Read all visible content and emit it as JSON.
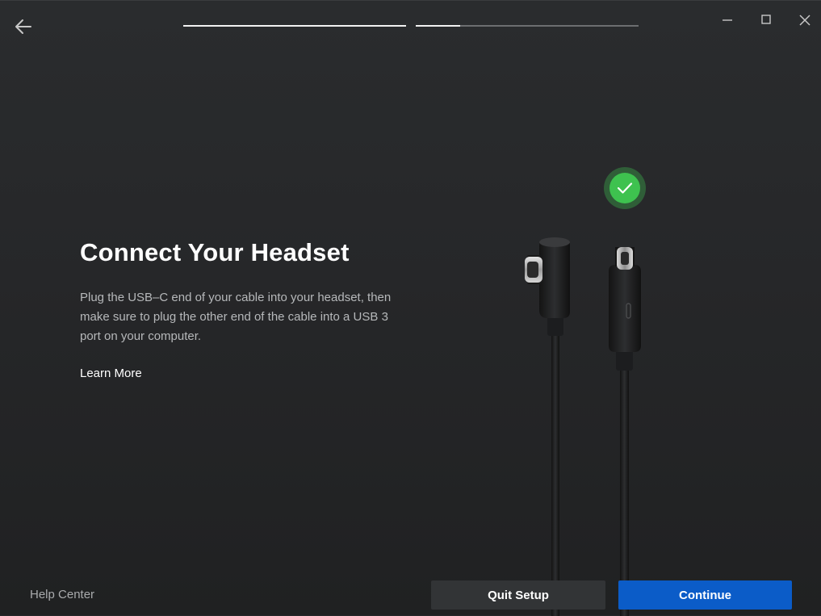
{
  "progress": {
    "steps": [
      {
        "fraction": 1.0
      },
      {
        "fraction": 0.2
      }
    ]
  },
  "header": {
    "back_icon": "arrow-left-icon",
    "window_controls": [
      "minimize-icon",
      "maximize-icon",
      "close-icon"
    ]
  },
  "main": {
    "title": "Connect Your Headset",
    "description": "Plug the USB–C end of your cable into your headset, then make sure to plug the other end of the cable into a USB 3 port on your computer.",
    "learn_more": "Learn More",
    "illustration": {
      "status_icon": "check-circle-icon",
      "status_color": "#3ec24f"
    }
  },
  "footer": {
    "help_center": "Help Center",
    "quit_label": "Quit Setup",
    "continue_label": "Continue"
  },
  "colors": {
    "background": "#26282a",
    "accent": "#0b5cc8",
    "secondary_button": "#323436",
    "success": "#3ec24f"
  }
}
